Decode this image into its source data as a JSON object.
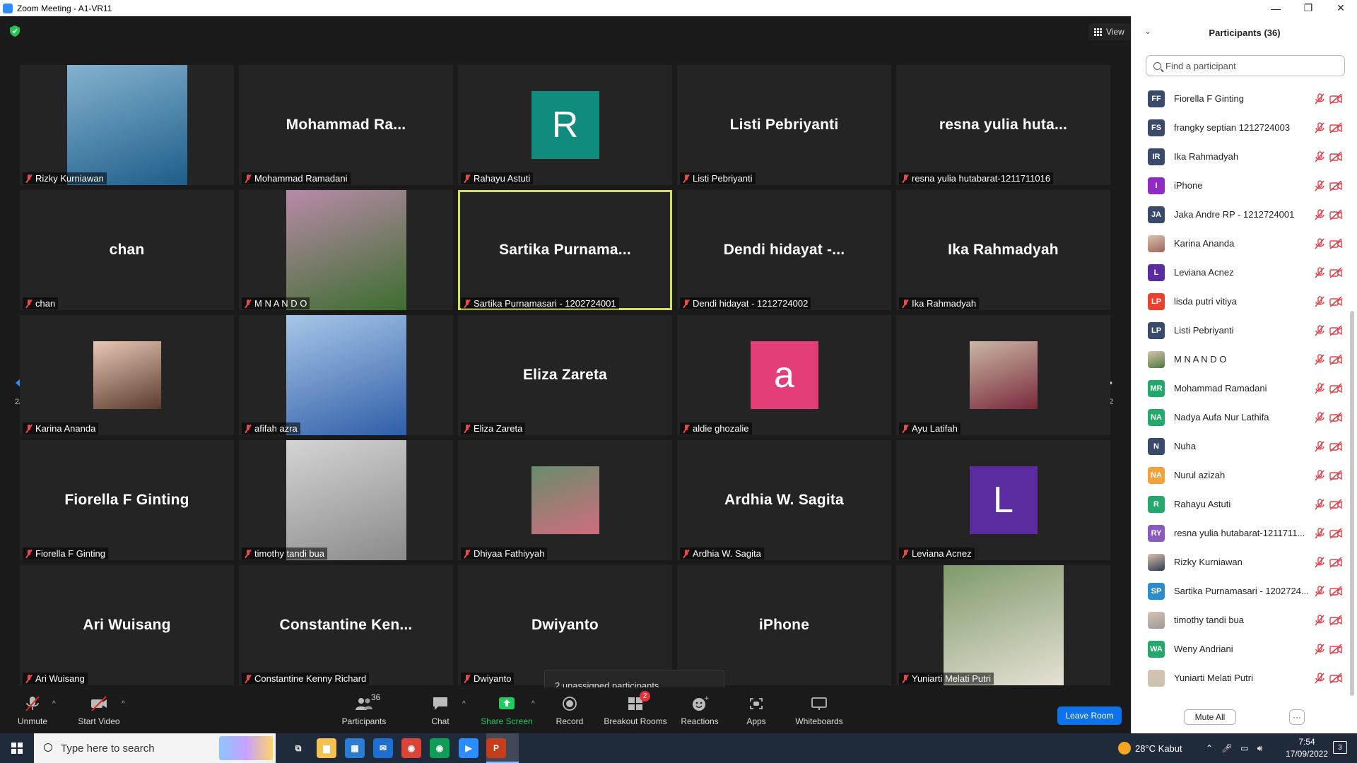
{
  "window": {
    "title": "Zoom Meeting - A1-VR11",
    "minimize": "—",
    "restore": "❐",
    "close": "✕"
  },
  "top": {
    "view_label": "View"
  },
  "tiles": [
    {
      "bigname": "",
      "caption": "Rizky Kurniawan",
      "kind": "photo",
      "photo_colors": [
        "#1e5e8a",
        "#84b2cf"
      ]
    },
    {
      "bigname": "Mohammad  Ra...",
      "caption": "Mohammad Ramadani",
      "kind": "name"
    },
    {
      "bigname": "",
      "caption": "Rahayu Astuti",
      "kind": "letter",
      "letter": "R",
      "color": "#0f8c7e"
    },
    {
      "bigname": "Listi Pebriyanti",
      "caption": "Listi Pebriyanti",
      "kind": "name"
    },
    {
      "bigname": "resna yulia huta...",
      "caption": "resna yulia hutabarat-1211711016",
      "kind": "name"
    },
    {
      "bigname": "chan",
      "caption": "chan",
      "kind": "name"
    },
    {
      "bigname": "",
      "caption": "M N A N D O",
      "kind": "photo",
      "photo_colors": [
        "#3d6e2f",
        "#b88aa8"
      ]
    },
    {
      "bigname": "Sartika  Purnama...",
      "caption": "Sartika Purnamasari - 1202724001",
      "kind": "name",
      "active": true
    },
    {
      "bigname": "Dendi hidayat -...",
      "caption": "Dendi hidayat - 1212724002",
      "kind": "name"
    },
    {
      "bigname": "Ika Rahmadyah",
      "caption": "Ika Rahmadyah",
      "kind": "name"
    },
    {
      "bigname": "",
      "caption": "Karina Ananda",
      "kind": "photo-small",
      "photo_colors": [
        "#5a3b2e",
        "#e8c7b4"
      ]
    },
    {
      "bigname": "",
      "caption": "afifah azra",
      "kind": "photo",
      "photo_colors": [
        "#2f5fa8",
        "#a8c6e8"
      ]
    },
    {
      "bigname": "Eliza Zareta",
      "caption": "Eliza Zareta",
      "kind": "name"
    },
    {
      "bigname": "",
      "caption": "aldie ghozalie",
      "kind": "letter",
      "letter": "a",
      "color": "#e33d7a"
    },
    {
      "bigname": "",
      "caption": "Ayu Latifah",
      "kind": "photo-small",
      "photo_colors": [
        "#7a2a3a",
        "#c9b6a6"
      ]
    },
    {
      "bigname": "Fiorella F Ginting",
      "caption": "Fiorella F Ginting",
      "kind": "name"
    },
    {
      "bigname": "",
      "caption": "timothy tandi bua",
      "kind": "photo",
      "photo_colors": [
        "#8a8a8a",
        "#d4d4d4"
      ]
    },
    {
      "bigname": "",
      "caption": "Dhiyaa Fathiyyah",
      "kind": "photo-small",
      "photo_colors": [
        "#cf6d7e",
        "#6a8c6e"
      ]
    },
    {
      "bigname": "Ardhia W. Sagita",
      "caption": "Ardhia W. Sagita",
      "kind": "name"
    },
    {
      "bigname": "",
      "caption": "Leviana Acnez",
      "kind": "letter",
      "letter": "L",
      "color": "#5a2ca0"
    },
    {
      "bigname": "Ari Wuisang",
      "caption": "Ari Wuisang",
      "kind": "name"
    },
    {
      "bigname": "Constantine  Ken...",
      "caption": "Constantine Kenny Richard",
      "kind": "name"
    },
    {
      "bigname": "Dwiyanto",
      "caption": "Dwiyanto",
      "kind": "name"
    },
    {
      "bigname": "iPhone",
      "caption": "",
      "kind": "name"
    },
    {
      "bigname": "",
      "caption": "Yuniarti Melati Putri",
      "kind": "photo",
      "photo_colors": [
        "#e6e1d6",
        "#7e9a6a"
      ]
    }
  ],
  "pager": {
    "left": "2/2",
    "right": "2/2"
  },
  "unassigned_tooltip": "2 unassigned participants",
  "toolbar": {
    "unmute": "Unmute",
    "start_video": "Start Video",
    "participants": "Participants",
    "participants_count": "36",
    "chat": "Chat",
    "share_screen": "Share Screen",
    "record": "Record",
    "breakout_rooms": "Breakout Rooms",
    "breakout_badge": "2",
    "reactions": "Reactions",
    "apps": "Apps",
    "whiteboards": "Whiteboards",
    "leave_room": "Leave Room"
  },
  "panel": {
    "title": "Participants (36)",
    "search_placeholder": "Find a participant",
    "mute_all": "Mute All",
    "more": "···",
    "participants": [
      {
        "initials": "FF",
        "name": "Fiorella F Ginting",
        "color": "#3a4a6a"
      },
      {
        "initials": "FS",
        "name": "frangky septian 1212724003",
        "color": "#3a4a6a"
      },
      {
        "initials": "IR",
        "name": "Ika Rahmadyah",
        "color": "#3a4a6a"
      },
      {
        "initials": "I",
        "name": "iPhone",
        "color": "#8e2cc4"
      },
      {
        "initials": "JA",
        "name": "Jaka Andre RP - 1212724001",
        "color": "#3a4a6a"
      },
      {
        "initials": "",
        "name": "Karina Ananda",
        "color": "#a0655a",
        "photo": true
      },
      {
        "initials": "L",
        "name": "Leviana Acnez",
        "color": "#5a2ca0"
      },
      {
        "initials": "LP",
        "name": "lisda putri vitiya",
        "color": "#e8412f"
      },
      {
        "initials": "LP",
        "name": "Listi Pebriyanti",
        "color": "#3a4a6a"
      },
      {
        "initials": "",
        "name": "M N A N D O",
        "color": "#4b7a3c",
        "photo": true
      },
      {
        "initials": "MR",
        "name": "Mohammad Ramadani",
        "color": "#25a86b"
      },
      {
        "initials": "NA",
        "name": "Nadya Aufa Nur Lathifa",
        "color": "#25a86b"
      },
      {
        "initials": "N",
        "name": "Nuha",
        "color": "#3a4a6a"
      },
      {
        "initials": "NA",
        "name": "Nurul azizah",
        "color": "#f2a23b"
      },
      {
        "initials": "R",
        "name": "Rahayu Astuti",
        "color": "#25a86b"
      },
      {
        "initials": "RY",
        "name": "resna yulia hutabarat-1211711...",
        "color": "#8a5ac0"
      },
      {
        "initials": "",
        "name": "Rizky Kurniawan",
        "color": "#2c3a4e",
        "photo": true
      },
      {
        "initials": "SP",
        "name": "Sartika Purnamasari - 1202724...",
        "color": "#2d8ccc"
      },
      {
        "initials": "",
        "name": "timothy tandi bua",
        "color": "#999999",
        "photo": true
      },
      {
        "initials": "WA",
        "name": "Weny Andriani",
        "color": "#25a86b"
      },
      {
        "initials": "",
        "name": "Yuniarti Melati Putri",
        "color": "#c9c2b2",
        "photo": true
      }
    ]
  },
  "taskbar": {
    "search_placeholder": "Type here to search",
    "weather": "28°C  Kabut",
    "time": "7:54",
    "date": "17/09/2022",
    "notifications": "3",
    "apps": [
      {
        "name": "task-view",
        "label": "⧉",
        "color": "transparent"
      },
      {
        "name": "file-explorer",
        "label": "▆",
        "color": "#f2c14e"
      },
      {
        "name": "store",
        "label": "▦",
        "color": "#2b7cd3"
      },
      {
        "name": "mail",
        "label": "✉",
        "color": "#1e6fd0"
      },
      {
        "name": "chrome",
        "label": "◉",
        "color": "#db4437"
      },
      {
        "name": "chrome-profile",
        "label": "◉",
        "color": "#0f9d58"
      },
      {
        "name": "zoom",
        "label": "▶",
        "color": "#2D8CFF"
      },
      {
        "name": "powerpoint",
        "label": "P",
        "color": "#c43e1c"
      }
    ]
  }
}
